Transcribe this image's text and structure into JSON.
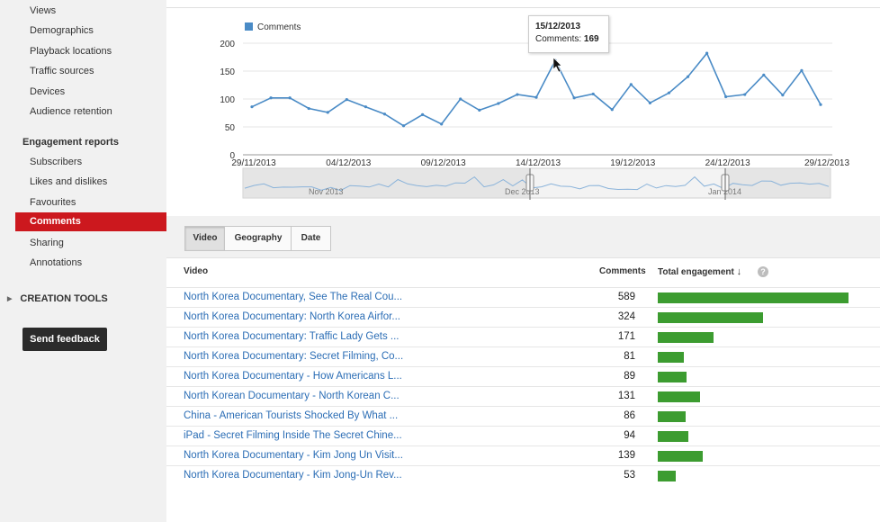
{
  "sidebar": {
    "items_top": [
      "Views",
      "Demographics",
      "Playback locations",
      "Traffic sources",
      "Devices",
      "Audience retention"
    ],
    "engagement_header": "Engagement reports",
    "engagement_items": [
      "Subscribers",
      "Likes and dislikes",
      "Favourites"
    ],
    "active_item": "Comments",
    "engagement_items_after": [
      "Sharing",
      "Annotations"
    ],
    "creation_tools": "CREATION TOOLS",
    "feedback_button": "Send feedback"
  },
  "chart_data": {
    "type": "line",
    "legend": [
      "Comments"
    ],
    "color": "#4a8bc6",
    "x_tick_labels": [
      "29/11/2013",
      "04/12/2013",
      "09/12/2013",
      "14/12/2013",
      "19/12/2013",
      "24/12/2013",
      "29/12/2013"
    ],
    "y_tick_labels": [
      "0",
      "50",
      "100",
      "150",
      "200"
    ],
    "ylim": [
      0,
      200
    ],
    "series": [
      {
        "name": "Comments",
        "x": [
          "29/11/2013",
          "30/11/2013",
          "01/12/2013",
          "02/12/2013",
          "03/12/2013",
          "04/12/2013",
          "05/12/2013",
          "06/12/2013",
          "07/12/2013",
          "08/12/2013",
          "09/12/2013",
          "10/12/2013",
          "11/12/2013",
          "12/12/2013",
          "13/12/2013",
          "14/12/2013",
          "15/12/2013",
          "16/12/2013",
          "17/12/2013",
          "18/12/2013",
          "19/12/2013",
          "20/12/2013",
          "21/12/2013",
          "22/12/2013",
          "23/12/2013",
          "24/12/2013",
          "25/12/2013",
          "26/12/2013",
          "27/12/2013",
          "28/12/2013",
          "29/12/2013"
        ],
        "values": [
          86,
          102,
          102,
          83,
          76,
          99,
          86,
          73,
          52,
          72,
          55,
          100,
          80,
          92,
          108,
          103,
          169,
          102,
          109,
          81,
          126,
          93,
          111,
          140,
          182,
          104,
          108,
          143,
          107,
          151,
          90
        ]
      }
    ],
    "navigator_labels": [
      "Nov 2013",
      "Dec 2013",
      "Jan 2014"
    ],
    "tooltip": {
      "date": "15/12/2013",
      "label": "Comments:",
      "value": "169"
    }
  },
  "tabs": [
    "Video",
    "Geography",
    "Date"
  ],
  "table": {
    "headers": {
      "video": "Video",
      "comments": "Comments",
      "engagement": "Total engagement"
    },
    "rows": [
      {
        "title": "North Korea Documentary, See The Real Cou...",
        "comments": "589",
        "engagement": 589
      },
      {
        "title": "North Korea Documentary: North Korea Airfor...",
        "comments": "324",
        "engagement": 324
      },
      {
        "title": "North Korea Documentary: Traffic Lady Gets ...",
        "comments": "171",
        "engagement": 171
      },
      {
        "title": "North Korea Documentary: Secret Filming, Co...",
        "comments": "81",
        "engagement": 81
      },
      {
        "title": "North Korea Documentary - How Americans L...",
        "comments": "89",
        "engagement": 89
      },
      {
        "title": "North Korean Documentary - North Korean C...",
        "comments": "131",
        "engagement": 131
      },
      {
        "title": "China - American Tourists Shocked By What ...",
        "comments": "86",
        "engagement": 86
      },
      {
        "title": "iPad - Secret Filming Inside The Secret Chine...",
        "comments": "94",
        "engagement": 94
      },
      {
        "title": "North Korea Documentary - Kim Jong Un Visit...",
        "comments": "139",
        "engagement": 139
      },
      {
        "title": "North Korea Documentary - Kim Jong-Un Rev...",
        "comments": "53",
        "engagement": 53
      }
    ]
  },
  "colors": {
    "active": "#cc181e",
    "bar": "#3c9c30",
    "link": "#2b6db5",
    "line": "#4a8bc6"
  }
}
